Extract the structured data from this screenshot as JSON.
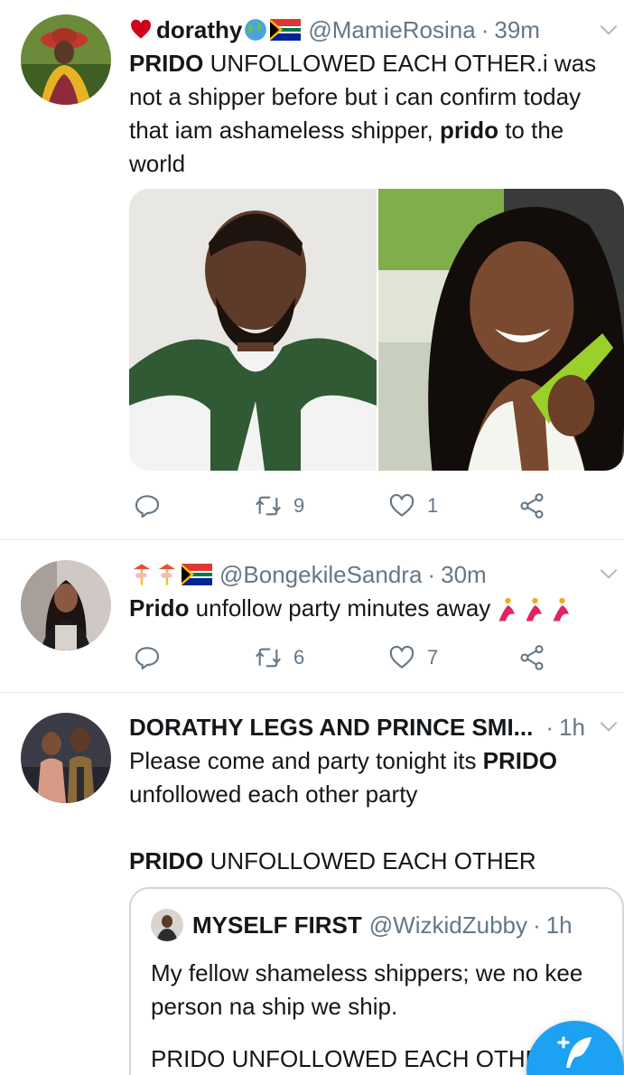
{
  "tweets": [
    {
      "name": "dorathy",
      "handle": "@MamieRosina",
      "time": "39m",
      "text_bold": "PRIDO",
      "text_1": " UNFOLLOWED EACH OTHER.i was not a shipper  before but i can confirm today that iam ashameless shipper, ",
      "text_bold_2": "prido",
      "text_2": " to the world",
      "retweets": "9",
      "likes": "1"
    },
    {
      "handle": "@BongekileSandra",
      "time": "30m",
      "text_bold": "Prido",
      "text_1": " unfollow party minutes away",
      "retweets": "6",
      "likes": "7"
    },
    {
      "name": "DORATHY LEGS AND PRINCE SMI...",
      "time": "1h",
      "text_line1_pre": "Please come and party tonight its ",
      "text_line1_bold": "PRIDO",
      "text_line2": "unfollowed each other party",
      "text_line3_bold": "PRIDO",
      "text_line3": " UNFOLLOWED EACH OTHER",
      "quote": {
        "name": "MYSELF FIRST",
        "handle": "@WizkidZubby",
        "time": "1h",
        "text": "My fellow shameless shippers; we no kee person na ship we ship.",
        "more": "PRIDO UNFOLLOWED EACH OTHER"
      }
    }
  ],
  "separator": "·",
  "icons": {
    "reply": "reply-icon",
    "retweet": "retweet-icon",
    "like": "heart-icon",
    "share": "share-icon",
    "caret": "chevron-down-icon",
    "compose": "compose-tweet-icon"
  },
  "colors": {
    "accent": "#1da1f2",
    "muted": "#657786",
    "divider": "#e1e8ed",
    "heart": "#e0245e"
  }
}
